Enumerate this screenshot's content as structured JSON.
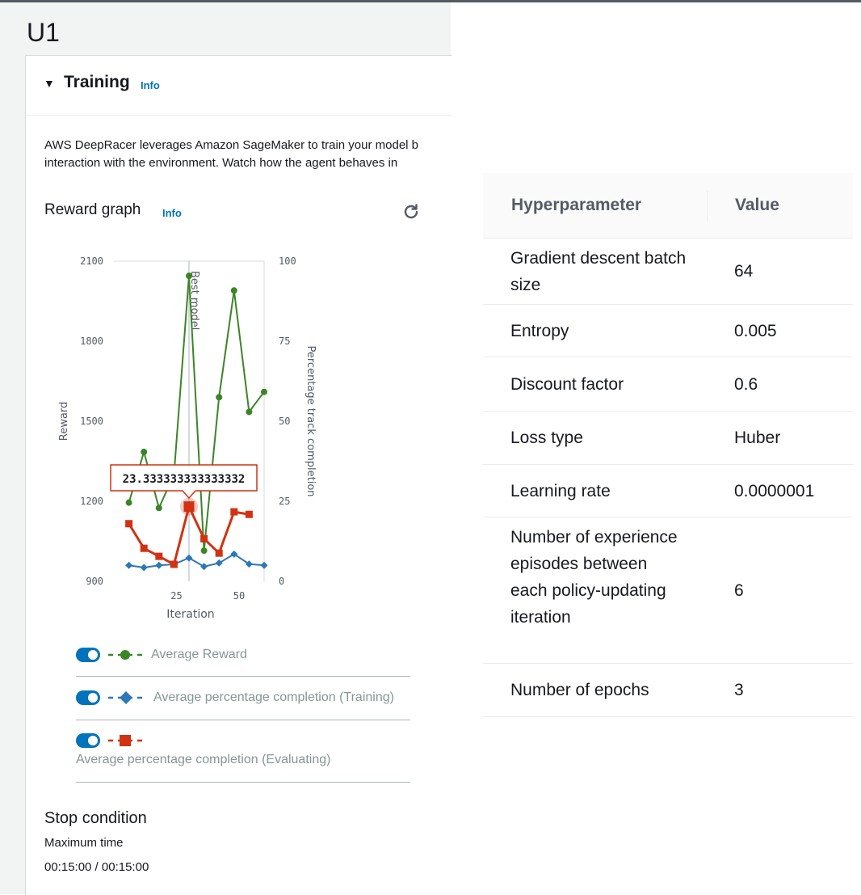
{
  "page": {
    "title": "U1"
  },
  "training": {
    "title": "Training",
    "info": "Info",
    "description_line1": "AWS DeepRacer leverages Amazon SageMaker to train your model b",
    "description_line2": "interaction with the environment. Watch how the agent behaves in"
  },
  "reward_graph": {
    "title": "Reward graph",
    "info": "Info",
    "refresh_icon": "refresh-icon"
  },
  "chart_data": {
    "type": "line",
    "xlabel": "Iteration",
    "ylabel": "Reward",
    "y2label": "Percentage track completion",
    "xlim": [
      0,
      60
    ],
    "ylim": [
      900,
      2100
    ],
    "y2lim": [
      0,
      100
    ],
    "x_ticks": [
      25,
      50
    ],
    "y_ticks": [
      900,
      1200,
      1500,
      1800,
      2100
    ],
    "y2_ticks": [
      0,
      25,
      50,
      75,
      100
    ],
    "best_model_x": 30,
    "best_model_label": "Best model",
    "tooltip": {
      "x": 30,
      "series": "Average percentage completion (Evaluating)",
      "text": "23.333333333333332"
    },
    "series": [
      {
        "name": "Average Reward",
        "axis": "left",
        "color": "#3b8527",
        "marker": "circle",
        "x": [
          6,
          12,
          18,
          24,
          30,
          36,
          42,
          48,
          54,
          60
        ],
        "y": [
          1195,
          1385,
          1175,
          1300,
          2045,
          1015,
          1590,
          1990,
          1535,
          1610
        ]
      },
      {
        "name": "Average percentage completion (Training)",
        "axis": "right",
        "color": "#2d77b7",
        "marker": "diamond",
        "x": [
          6,
          12,
          18,
          24,
          30,
          36,
          42,
          48,
          54,
          60
        ],
        "y": [
          5,
          4.3,
          5,
          5.3,
          7.3,
          4.6,
          5.7,
          8.5,
          5.4,
          5
        ]
      },
      {
        "name": "Average percentage completion (Evaluating)",
        "axis": "right",
        "color": "#d13212",
        "marker": "square",
        "x": [
          6,
          12,
          18,
          24,
          30,
          36,
          42,
          48,
          54
        ],
        "y": [
          18,
          10.3,
          7.8,
          5.3,
          23.33,
          13.3,
          8.8,
          21.7,
          20.9
        ]
      }
    ]
  },
  "legend": [
    {
      "label": "Average Reward",
      "enabled": true
    },
    {
      "label": "Average percentage completion (Training)",
      "enabled": true
    },
    {
      "label": "Average percentage completion (Evaluating)",
      "enabled": true
    }
  ],
  "stop_condition": {
    "title": "Stop condition",
    "label": "Maximum time",
    "value": "00:15:00 / 00:15:00"
  },
  "hyperparameters": {
    "header_name": "Hyperparameter",
    "header_value": "Value",
    "rows": [
      {
        "name": "Gradient descent batch size",
        "value": "64"
      },
      {
        "name": "Entropy",
        "value": "0.005"
      },
      {
        "name": "Discount factor",
        "value": "0.6"
      },
      {
        "name": "Loss type",
        "value": "Huber"
      },
      {
        "name": "Learning rate",
        "value": "0.0000001"
      },
      {
        "name": "Number of experience episodes between each policy-updating iteration",
        "value": "6"
      },
      {
        "name": "Number of epochs",
        "value": "3"
      }
    ]
  }
}
